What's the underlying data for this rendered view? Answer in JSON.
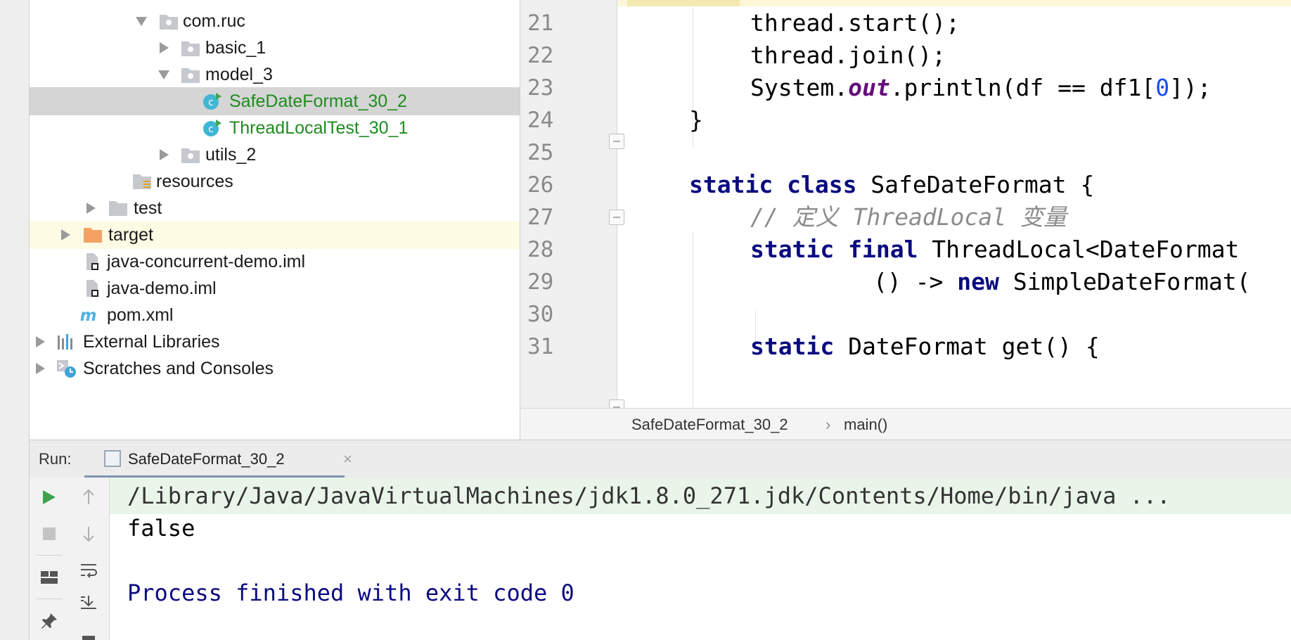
{
  "project_tree": {
    "items": [
      {
        "label": "com.ruc"
      },
      {
        "label": "basic_1"
      },
      {
        "label": "model_3"
      },
      {
        "label": "SafeDateFormat_30_2"
      },
      {
        "label": "ThreadLocalTest_30_1"
      },
      {
        "label": "utils_2"
      },
      {
        "label": "resources"
      },
      {
        "label": "test"
      },
      {
        "label": "target"
      },
      {
        "label": "java-concurrent-demo.iml"
      },
      {
        "label": "java-demo.iml"
      },
      {
        "label": "pom.xml"
      },
      {
        "label": "External Libraries"
      },
      {
        "label": "Scratches and Consoles"
      }
    ]
  },
  "editor": {
    "lines": [
      {
        "num": "21",
        "tokens": [
          {
            "t": "thread.start();"
          }
        ]
      },
      {
        "num": "22",
        "tokens": [
          {
            "t": "thread.join();"
          }
        ]
      },
      {
        "num": "23",
        "tokens": [
          {
            "t": "System."
          },
          {
            "t": "out",
            "c": "st"
          },
          {
            "t": ".println(df == df1["
          },
          {
            "t": "0",
            "c": "num"
          },
          {
            "t": "]);"
          }
        ]
      },
      {
        "num": "24",
        "tokens": [
          {
            "t": "}"
          }
        ]
      },
      {
        "num": "25",
        "tokens": []
      },
      {
        "num": "26",
        "tokens": [
          {
            "t": "static",
            "c": "kw"
          },
          {
            "t": " "
          },
          {
            "t": "class",
            "c": "kw"
          },
          {
            "t": " SafeDateFormat {"
          }
        ]
      },
      {
        "num": "27",
        "tokens": [
          {
            "t": "// 定义 ThreadLocal 变量",
            "c": "cm"
          }
        ]
      },
      {
        "num": "28",
        "tokens": [
          {
            "t": "static",
            "c": "kw"
          },
          {
            "t": " "
          },
          {
            "t": "final",
            "c": "kw"
          },
          {
            "t": " ThreadLocal<DateFormat"
          }
        ]
      },
      {
        "num": "29",
        "tokens": [
          {
            "t": "() -> "
          },
          {
            "t": "new",
            "c": "kw"
          },
          {
            "t": " SimpleDateFormat("
          }
        ]
      },
      {
        "num": "30",
        "tokens": []
      },
      {
        "num": "31",
        "tokens": [
          {
            "t": "static",
            "c": "kw"
          },
          {
            "t": " DateFormat get() {"
          }
        ]
      }
    ]
  },
  "breadcrumb": {
    "class_name": "SafeDateFormat_30_2",
    "separator": "›",
    "method": "main()"
  },
  "run": {
    "label": "Run:",
    "tab_title": "SafeDateFormat_30_2",
    "close_glyph": "×",
    "console_lines": [
      "/Library/Java/JavaVirtualMachines/jdk1.8.0_271.jdk/Contents/Home/bin/java ...",
      "false",
      "",
      "Process finished with exit code 0"
    ]
  },
  "colors": {
    "keyword": "#0a0a80",
    "static_field": "#660e7a",
    "number": "#1750eb",
    "comment": "#8c8c8c",
    "run_class_green": "#1e8c1e",
    "run_button_green": "#3fa34d"
  }
}
